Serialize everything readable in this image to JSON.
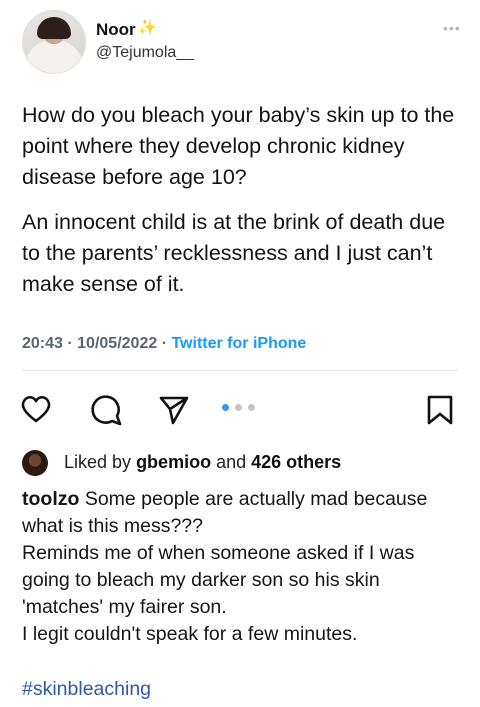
{
  "tweet": {
    "author": {
      "name": "Noor",
      "handle": "@Tejumola__"
    },
    "paragraphs": [
      "How do you bleach your baby’s skin up to the point where they develop chronic kidney disease before age 10?",
      "An innocent child is at the brink of death due to the parents’ recklessness and I just can’t make sense of it."
    ],
    "time": "20:43",
    "date": "10/05/2022",
    "source": "Twitter for iPhone",
    "sep": "·"
  },
  "post": {
    "likes": {
      "prefix": "Liked by",
      "user": "gbemioo",
      "middle": "and",
      "others": "426 others"
    },
    "caption": {
      "username": "toolzo",
      "line1": "Some people are actually mad because what is this mess???",
      "line2": "Reminds me of when someone asked  if I was going to bleach my darker son so his skin 'matches' my fairer son.",
      "line3": "I legit couldn't speak for a few minutes."
    },
    "hashtag": "#skinbleaching",
    "carousel": {
      "count": 3,
      "active": 0
    },
    "colors": {
      "active_dot": "#3897f0",
      "inactive_dot": "#c4c4c4",
      "link": "#1d9bf0"
    }
  },
  "icons": [
    "heart-icon",
    "comment-icon",
    "share-icon",
    "bookmark-icon",
    "more-icon",
    "sparkle-icon"
  ]
}
